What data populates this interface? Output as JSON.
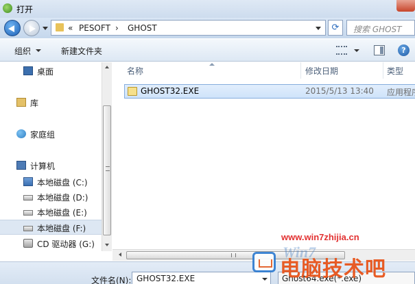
{
  "window": {
    "title": "打开"
  },
  "address": {
    "chevron": "«",
    "segments": [
      "PESOFT",
      "GHOST"
    ],
    "separator": "›",
    "search_placeholder": "搜索 GHOST"
  },
  "toolbar": {
    "organize_label": "组织",
    "new_folder_label": "新建文件夹",
    "help_label": "?"
  },
  "nav": {
    "items": [
      {
        "label": "桌面",
        "icon": "desktop-icon"
      },
      {
        "label": "库",
        "icon": "library-icon"
      },
      {
        "label": "家庭组",
        "icon": "homegroup-icon"
      },
      {
        "label": "计算机",
        "icon": "computer-icon"
      },
      {
        "label": "本地磁盘 (C:)",
        "icon": "system-drive-icon"
      },
      {
        "label": "本地磁盘 (D:)",
        "icon": "drive-icon"
      },
      {
        "label": "本地磁盘 (E:)",
        "icon": "drive-icon"
      },
      {
        "label": "本地磁盘 (F:)",
        "icon": "drive-icon",
        "selected": true
      },
      {
        "label": "CD 驱动器 (G:)",
        "icon": "cd-drive-icon"
      }
    ]
  },
  "columns": {
    "name": "名称",
    "date": "修改日期",
    "type": "类型"
  },
  "files": [
    {
      "name": "GHOST32.EXE",
      "date": "2015/5/13 13:40",
      "type": "应用程序",
      "selected": true
    }
  ],
  "bottom": {
    "filename_label": "文件名(N):",
    "filename_value": "GHOST32.EXE",
    "filetype_value": "Ghost64.exe(*.exe)"
  },
  "watermark": {
    "url": "www.win7zhijia.cn",
    "logo": "Win7",
    "text": "电脑技术吧"
  },
  "colors": {
    "accent": "#3a78c2",
    "selection": "#cfe3fa",
    "watermark_orange": "#e8541a",
    "watermark_red": "#e02020"
  }
}
